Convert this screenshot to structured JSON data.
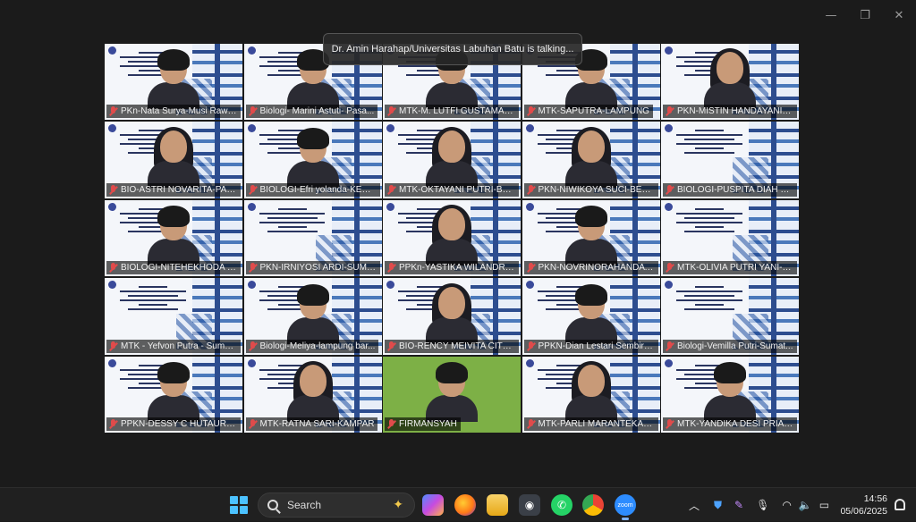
{
  "window": {
    "controls": {
      "minimize": "—",
      "restore": "❐",
      "close": "✕"
    }
  },
  "talking_banner": "Dr. Amin Harahap/Universitas Labuhan Batu is talking...",
  "participants": [
    {
      "name": "PKn-Nata Surya-Musi Rawas",
      "muted": true,
      "appearance": "man"
    },
    {
      "name": "Biologi- Marini Astuti- Pasa...",
      "muted": true,
      "appearance": "woman"
    },
    {
      "name": "MTK-M. LUTFI GUSTAMAN-...",
      "muted": true,
      "appearance": "man"
    },
    {
      "name": "MTK-SAPUTRA-LAMPUNG",
      "muted": true,
      "appearance": "man"
    },
    {
      "name": "PKN-MISTIN HANDAYANI-L...",
      "muted": true,
      "appearance": "hijab"
    },
    {
      "name": "BIO-ASTRI NOVARITA-PADA...",
      "muted": true,
      "appearance": "hijab"
    },
    {
      "name": "BIOLOGI-Efri yolanda-KERIN...",
      "muted": true,
      "appearance": "man"
    },
    {
      "name": "MTK-OKTAYANI PUTRI-BATA...",
      "muted": true,
      "appearance": "hijab"
    },
    {
      "name": "PKN-NIWIKOYA SUCI-BELIT...",
      "muted": true,
      "appearance": "hijab"
    },
    {
      "name": "BIOLOGI-PUSPITA DIAH PAL...",
      "muted": true,
      "appearance": "none"
    },
    {
      "name": "BIOLOGI-NITEHEKHODA BU...",
      "muted": true,
      "appearance": "man"
    },
    {
      "name": "PKN-IRNIYOSI ARDI-SUMAT...",
      "muted": true,
      "appearance": "none"
    },
    {
      "name": "PPKn-YASTIKA WILANDRI-P...",
      "muted": true,
      "appearance": "hijab"
    },
    {
      "name": "PKN-NOVRINORAHANDAYA...",
      "muted": true,
      "appearance": "woman"
    },
    {
      "name": "MTK-OLIVIA PUTRI YANI-PE...",
      "muted": true,
      "appearance": "none"
    },
    {
      "name": "MTK - Yefvon Putra - Sumat...",
      "muted": true,
      "appearance": "none"
    },
    {
      "name": "Biologi-Meliya-lampung bar...",
      "muted": true,
      "appearance": "woman"
    },
    {
      "name": "BIO-RENCY MEIVITA CITRA-...",
      "muted": true,
      "appearance": "hijab"
    },
    {
      "name": "PPKN-Dian Lestari Sembirin...",
      "muted": true,
      "appearance": "man"
    },
    {
      "name": "Biologi-Vemilla Putri-Sumat...",
      "muted": true,
      "appearance": "none"
    },
    {
      "name": "PPKN-DESSY C HUTAURUK-...",
      "muted": true,
      "appearance": "woman"
    },
    {
      "name": "MTK-RATNA SARI-KAMPAR",
      "muted": true,
      "appearance": "hijab"
    },
    {
      "name": "FIRMANSYAH",
      "muted": true,
      "appearance": "man",
      "background": "green"
    },
    {
      "name": "MTK-PARLI MARANTEKA, S...",
      "muted": true,
      "appearance": "hijab"
    },
    {
      "name": "MTK-YANDIKA DESI PRIANS...",
      "muted": true,
      "appearance": "man"
    }
  ],
  "taskbar": {
    "search_label": "Search",
    "apps": [
      "copilot-icon",
      "firefox-icon",
      "file-explorer-icon",
      "camera-icon",
      "whatsapp-icon",
      "chrome-icon",
      "zoom-icon"
    ],
    "zoom_label": "zoom",
    "time": "14:56",
    "date": "05/06/2025"
  },
  "colors": {
    "accent": "#4cc2ff",
    "muted_mic": "#e04b4b",
    "slide_blue": "#2c5aa6"
  }
}
